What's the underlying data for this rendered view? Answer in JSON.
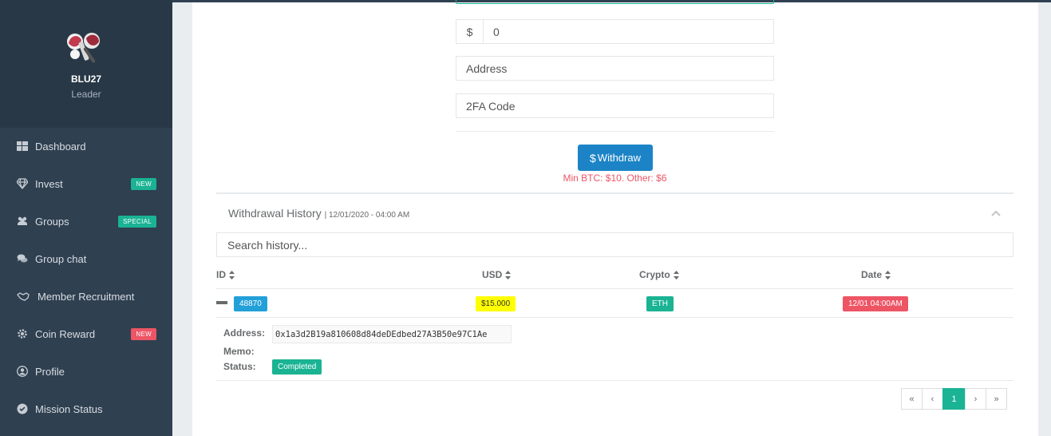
{
  "user": {
    "name": "BLU27",
    "role": "Leader"
  },
  "sidebar": {
    "items": [
      {
        "label": "Dashboard",
        "icon": "dashboard-icon",
        "badge": ""
      },
      {
        "label": "Invest",
        "icon": "diamond-icon",
        "badge": "NEW"
      },
      {
        "label": "Groups",
        "icon": "users-icon",
        "badge": "SPECIAL"
      },
      {
        "label": "Group chat",
        "icon": "chat-icon",
        "badge": ""
      },
      {
        "label": "Member Recruitment",
        "icon": "handshake-icon",
        "badge": ""
      },
      {
        "label": "Coin Reward",
        "icon": "gear-icon",
        "badge": "NEW"
      },
      {
        "label": "Profile",
        "icon": "user-circle-icon",
        "badge": ""
      },
      {
        "label": "Mission Status",
        "icon": "check-circle-icon",
        "badge": ""
      }
    ]
  },
  "form": {
    "currency_symbol": "$",
    "amount_value": "0",
    "address_placeholder": "Address",
    "twofa_placeholder": "2FA Code",
    "withdraw_label": "Withdraw",
    "min_note": "Min BTC: $10. Other: $6"
  },
  "history": {
    "title": "Withdrawal History",
    "date": "| 12/01/2020 - 04:00 AM",
    "search_placeholder": "Search history...",
    "columns": [
      "ID",
      "USD",
      "Crypto",
      "Date"
    ],
    "rows": [
      {
        "id": "48870",
        "usd": "$15.000",
        "crypto": "ETH",
        "date": "12/01 04:00AM",
        "address_label": "Address:",
        "address": "0x1a3d2B19a810608d84deDEdbed27A3B50e97C1Ae",
        "memo_label": "Memo:",
        "status_label": "Status:",
        "status": "Completed"
      }
    ]
  },
  "pagination": {
    "first": "«",
    "prev": "‹",
    "current": "1",
    "next": "›",
    "last": "»"
  },
  "colors": {
    "sidebar": "#2f4050",
    "primary": "#1ab394",
    "button": "#1c84c6",
    "danger": "#ed5565",
    "highlight": "#ffff00"
  }
}
